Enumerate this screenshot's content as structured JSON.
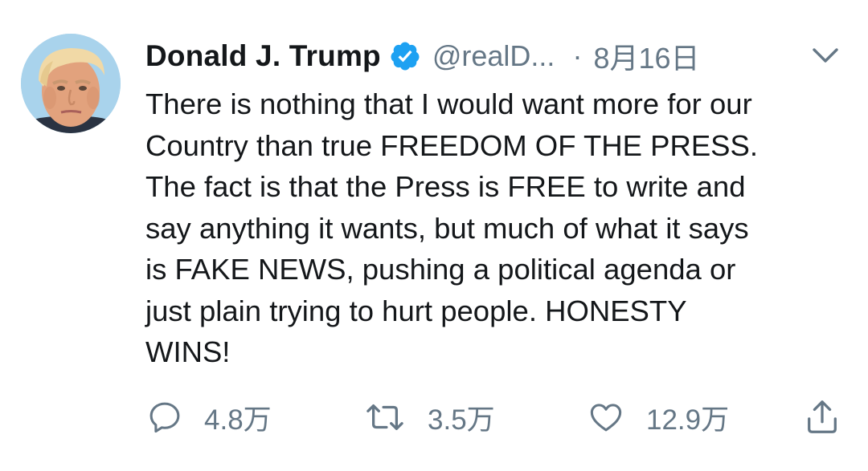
{
  "tweet": {
    "display_name": "Donald J. Trump",
    "handle": "@realD...",
    "separator": "·",
    "date": "8月16日",
    "text": "There is nothing that I would want more for our\nCountry than true FREEDOM OF THE PRESS.\nThe fact is that the Press is FREE to write and\nsay anything it wants, but much of what it says\nis FAKE NEWS, pushing a political agenda or\njust plain trying to hurt people. HONESTY\nWINS!",
    "verified": true
  },
  "actions": {
    "reply_count": "4.8万",
    "retweet_count": "3.5万",
    "like_count": "12.9万"
  },
  "icons": {
    "avatar": "profile-photo",
    "verified": "verified-badge-icon",
    "caret": "chevron-down-icon",
    "reply": "reply-icon",
    "retweet": "retweet-icon",
    "like": "heart-icon",
    "share": "share-icon"
  },
  "colors": {
    "text": "#14171a",
    "secondary": "#657786",
    "verified_blue": "#1da1f2",
    "background": "#ffffff"
  }
}
